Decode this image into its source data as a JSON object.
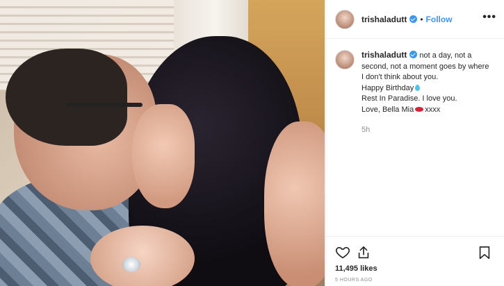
{
  "post": {
    "username": "trishaladutt",
    "follow_label": "Follow",
    "separator": "•",
    "more_label": "•••"
  },
  "caption": {
    "username": "trishaladutt",
    "line1": "not a day, not a",
    "line2": "second, not a moment goes by where",
    "line3": "I don't think about you.",
    "line4": "Happy Birthday",
    "line5": "Rest In Paradise. I love you.",
    "line6a": "Love, Bella Mia",
    "line6b": "xxxx",
    "time": "5h"
  },
  "footer": {
    "likes": "11,495 likes",
    "time_ago": "5 HOURS AGO"
  },
  "icons": {
    "like": "heart-icon",
    "share": "share-icon",
    "save": "bookmark-icon",
    "verified": "verified-badge-icon",
    "balloon": "balloon-emoji-icon",
    "kiss": "kiss-emoji-icon"
  },
  "colors": {
    "link_blue": "#3897f0",
    "text": "#262626",
    "muted": "#8e8e8e"
  }
}
